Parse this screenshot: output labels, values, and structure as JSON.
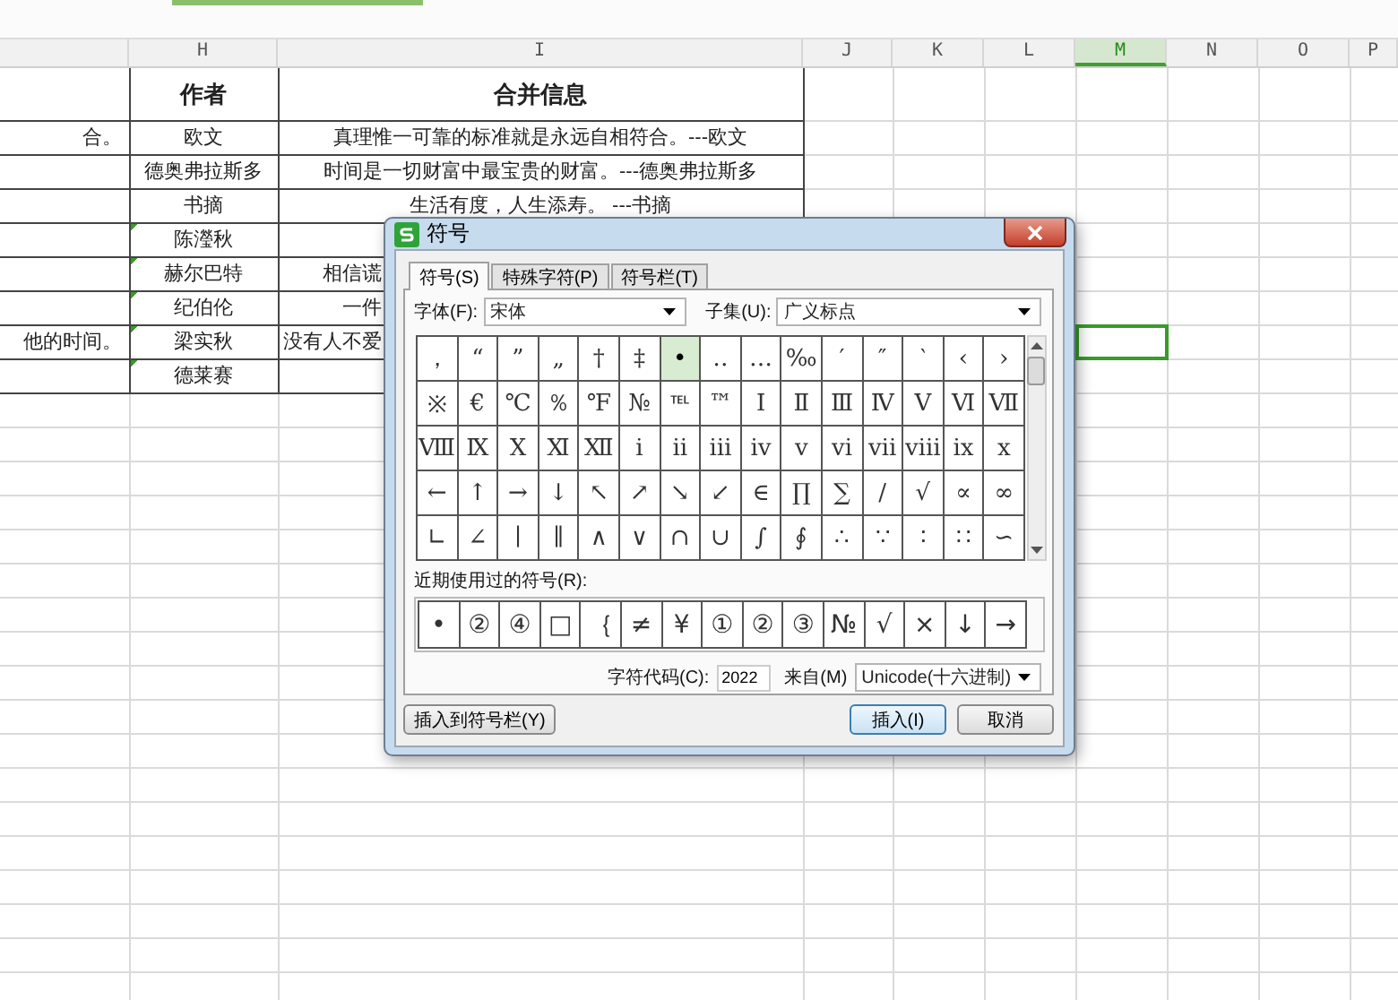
{
  "columns": [
    {
      "label": "H",
      "selected": false
    },
    {
      "label": "I",
      "selected": false
    },
    {
      "label": "J",
      "selected": false
    },
    {
      "label": "K",
      "selected": false
    },
    {
      "label": "L",
      "selected": false
    },
    {
      "label": "M",
      "selected": true
    },
    {
      "label": "N",
      "selected": false
    },
    {
      "label": "O",
      "selected": false
    },
    {
      "label": "P",
      "selected": false
    }
  ],
  "table_header": {
    "author": "作者",
    "merged": "合并信息"
  },
  "rows": [
    {
      "column_g": "合。",
      "author": "欧文",
      "merged": "真理惟一可靠的标准就是永远自相符合。---欧文",
      "covered": false,
      "flagged": false,
      "selected": false
    },
    {
      "author": "德奥弗拉斯多",
      "merged": "时间是一切财富中最宝贵的财富。---德奥弗拉斯多",
      "covered": false,
      "flagged": false,
      "selected": false
    },
    {
      "author": "书摘",
      "merged": "生活有度，人生添寿。  ---书摘",
      "covered": false,
      "flagged": false,
      "selected": false
    },
    {
      "author": "陈瀅秋",
      "flagged": true,
      "selected": false
    },
    {
      "author": "赫尔巴特",
      "merged": "相信谎",
      "covered": true,
      "flagged": true,
      "selected": false
    },
    {
      "author": "纪伯伦",
      "merged": "一件",
      "covered": true,
      "flagged": true,
      "selected": false
    },
    {
      "column_g": "他的时间。",
      "author": "梁实秋",
      "merged": "没有人不爱",
      "covered": true,
      "flagged": true,
      "selected": true
    },
    {
      "author": "德莱赛",
      "flagged": true,
      "selected": false
    }
  ],
  "dialog": {
    "title": "符号",
    "tabs": [
      {
        "label": "符号(S)",
        "selected": true
      },
      {
        "label": "特殊字符(P)",
        "selected": false
      },
      {
        "label": "符号栏(T)",
        "selected": false
      }
    ],
    "font_label": "字体(F):",
    "font_value": "宋体",
    "subset_label": "子集(U):",
    "subset_value": "广义标点",
    "symbol_grid": [
      [
        {
          "char": "，",
          "selected": false
        },
        {
          "char": "“",
          "selected": false
        },
        {
          "char": "”",
          "selected": false
        },
        {
          "char": "„",
          "selected": false
        },
        {
          "char": "†",
          "selected": false
        },
        {
          "char": "‡",
          "selected": false
        },
        {
          "char": "•",
          "selected": true
        },
        {
          "char": "‥",
          "selected": false
        },
        {
          "char": "…",
          "selected": false
        },
        {
          "char": "‰",
          "selected": false
        },
        {
          "char": "′",
          "selected": false
        },
        {
          "char": "″",
          "selected": false
        },
        {
          "char": "‵",
          "selected": false
        },
        {
          "char": "‹",
          "selected": false
        },
        {
          "char": "›",
          "selected": false
        }
      ],
      [
        {
          "char": "※",
          "selected": false
        },
        {
          "char": "€",
          "selected": false
        },
        {
          "char": "℃",
          "selected": false
        },
        {
          "char": "％",
          "selected": false
        },
        {
          "char": "℉",
          "selected": false
        },
        {
          "char": "№",
          "selected": false
        },
        {
          "char": "℡",
          "selected": false
        },
        {
          "char": "™",
          "selected": false
        },
        {
          "char": "Ⅰ",
          "selected": false
        },
        {
          "char": "Ⅱ",
          "selected": false
        },
        {
          "char": "Ⅲ",
          "selected": false
        },
        {
          "char": "Ⅳ",
          "selected": false
        },
        {
          "char": "Ⅴ",
          "selected": false
        },
        {
          "char": "Ⅵ",
          "selected": false
        },
        {
          "char": "Ⅶ",
          "selected": false
        }
      ],
      [
        {
          "char": "Ⅷ",
          "selected": false
        },
        {
          "char": "Ⅸ",
          "selected": false
        },
        {
          "char": "Ⅹ",
          "selected": false
        },
        {
          "char": "Ⅺ",
          "selected": false
        },
        {
          "char": "Ⅻ",
          "selected": false
        },
        {
          "char": "ⅰ",
          "selected": false
        },
        {
          "char": "ⅱ",
          "selected": false
        },
        {
          "char": "ⅲ",
          "selected": false
        },
        {
          "char": "ⅳ",
          "selected": false
        },
        {
          "char": "ⅴ",
          "selected": false
        },
        {
          "char": "ⅵ",
          "selected": false
        },
        {
          "char": "ⅶ",
          "selected": false
        },
        {
          "char": "ⅷ",
          "selected": false
        },
        {
          "char": "ⅸ",
          "selected": false
        },
        {
          "char": "ⅹ",
          "selected": false
        }
      ],
      [
        {
          "char": "←",
          "selected": false
        },
        {
          "char": "↑",
          "selected": false
        },
        {
          "char": "→",
          "selected": false
        },
        {
          "char": "↓",
          "selected": false
        },
        {
          "char": "↖",
          "selected": false
        },
        {
          "char": "↗",
          "selected": false
        },
        {
          "char": "↘",
          "selected": false
        },
        {
          "char": "↙",
          "selected": false
        },
        {
          "char": "∈",
          "selected": false
        },
        {
          "char": "∏",
          "selected": false
        },
        {
          "char": "∑",
          "selected": false
        },
        {
          "char": "∕",
          "selected": false
        },
        {
          "char": "√",
          "selected": false
        },
        {
          "char": "∝",
          "selected": false
        },
        {
          "char": "∞",
          "selected": false
        }
      ],
      [
        {
          "char": "∟",
          "selected": false
        },
        {
          "char": "∠",
          "selected": false
        },
        {
          "char": "∣",
          "selected": false
        },
        {
          "char": "∥",
          "selected": false
        },
        {
          "char": "∧",
          "selected": false
        },
        {
          "char": "∨",
          "selected": false
        },
        {
          "char": "∩",
          "selected": false
        },
        {
          "char": "∪",
          "selected": false
        },
        {
          "char": "∫",
          "selected": false
        },
        {
          "char": "∮",
          "selected": false
        },
        {
          "char": "∴",
          "selected": false
        },
        {
          "char": "∵",
          "selected": false
        },
        {
          "char": "∶",
          "selected": false
        },
        {
          "char": "∷",
          "selected": false
        },
        {
          "char": "∽",
          "selected": false
        }
      ]
    ],
    "recent_label": "近期使用过的符号(R):",
    "recent_symbols": [
      "•",
      "②",
      "④",
      "□",
      "｛",
      "≠",
      "¥",
      "①",
      "②",
      "③",
      "№",
      "√",
      "×",
      "↓",
      "→"
    ],
    "code_label": "字符代码(C):",
    "code_value": "2022",
    "from_label": "来自(M)",
    "from_value": "Unicode(十六进制)",
    "buttons": [
      {
        "label": "插入到符号栏(Y)",
        "kind": "secondary"
      },
      {
        "label": "插入(I)",
        "kind": "default"
      },
      {
        "label": "取消",
        "kind": "secondary"
      }
    ]
  }
}
